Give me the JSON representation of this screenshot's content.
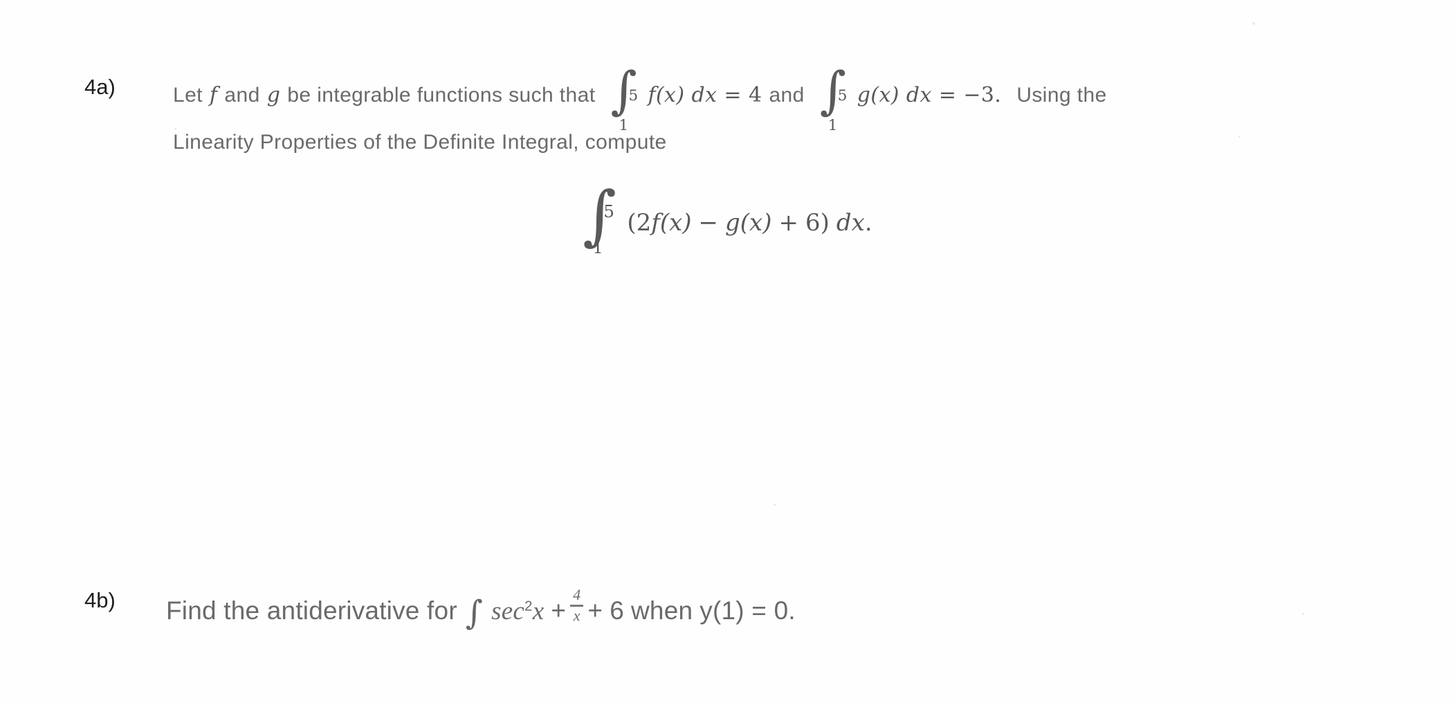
{
  "document": {
    "kind": "scanned-math-worksheet",
    "ink_color": "#6e6e6e",
    "label_color": "#1e1e1e",
    "background_color": "#ffffff"
  },
  "problems": [
    {
      "label": "4a)",
      "line1": {
        "before_integral": "Let f and g be integrable functions such that",
        "text_lead": "Let",
        "var_f": "f",
        "and_1": "and",
        "var_g": "g",
        "text_mid": "be integrable functions such that",
        "integral_1": {
          "symbol": "∫",
          "upper": "5",
          "lower": "1",
          "integrand": "f(x)",
          "differential": "dx",
          "equals": "=",
          "value": "4"
        },
        "conjunction": "and",
        "integral_2": {
          "symbol": "∫",
          "upper": "5",
          "lower": "1",
          "integrand": "g(x)",
          "differential": "dx",
          "equals": "=",
          "value": "−3."
        },
        "tail": "Using the"
      },
      "line2": "Linearity Properties of the Definite Integral, compute",
      "display_equation": {
        "symbol": "∫",
        "upper": "5",
        "lower": "1",
        "integrand": "(2f(x) − g(x) + 6)",
        "open_paren": "(",
        "coef": "2",
        "fx": "f(x)",
        "minus": "−",
        "gx": "g(x)",
        "plus": "+",
        "const": "6",
        "close_paren": ")",
        "differential": "dx",
        "period": "."
      }
    },
    {
      "label": "4b)",
      "text_lead": "Find the antiderivative for",
      "integral_symbol": "∫",
      "sec": "sec",
      "exponent": "2",
      "variable_x": "x",
      "plus_1": "+",
      "fraction": {
        "numerator": "4",
        "denominator": "x"
      },
      "plus_2": "+",
      "constant": "6",
      "when": "when",
      "condition": "y(1) = 0.",
      "full_text": "Find the antiderivative for ∫ sec²x + 4/x + 6 when y(1) = 0."
    }
  ]
}
